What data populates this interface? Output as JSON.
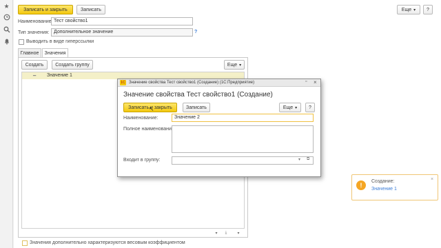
{
  "sidebar": {
    "icons": [
      "star-icon",
      "history-icon",
      "search-icon",
      "bell-icon"
    ]
  },
  "toolbar": {
    "save_close_label": "Записать и закрыть",
    "save_label": "Записать",
    "more_label": "Еще",
    "help_label": "?"
  },
  "form": {
    "name_label": "Наименование:",
    "name_value": "Тест свойство1",
    "type_label": "Тип значения:",
    "type_value": "Дополнительное значение",
    "type_help": "?",
    "hyperlink_label": "Выводить в виде гиперссылки",
    "weight_label": "Значения дополнительно характеризуются весовым коэффициентом"
  },
  "tabs": [
    {
      "label": "Главное"
    },
    {
      "label": "Значения"
    }
  ],
  "values_panel": {
    "create_label": "Создать",
    "create_group_label": "Создать группу",
    "more_label": "Еще",
    "items": [
      {
        "label": "Значение 1"
      }
    ]
  },
  "dialog": {
    "window_title": "Значение свойства Тест свойство1 (Создание)  (1С:Предприятие)",
    "heading": "Значение свойства Тест свойство1 (Создание)",
    "save_close_label": "Записать и закрыть",
    "save_label": "Записать",
    "more_label": "Еще",
    "help_label": "?",
    "name_label": "Наименование:",
    "name_value": "Значение 2",
    "full_name_label": "Полное наименование:",
    "full_name_value": "",
    "group_label": "Входит в группу:",
    "group_value": ""
  },
  "notification": {
    "title": "Создание:",
    "link": "Значение 1"
  },
  "colors": {
    "primary_button": "#f3c80f",
    "link": "#3a7cd6",
    "notification_border": "#f0c674",
    "input_focus_border": "#f0c040"
  }
}
